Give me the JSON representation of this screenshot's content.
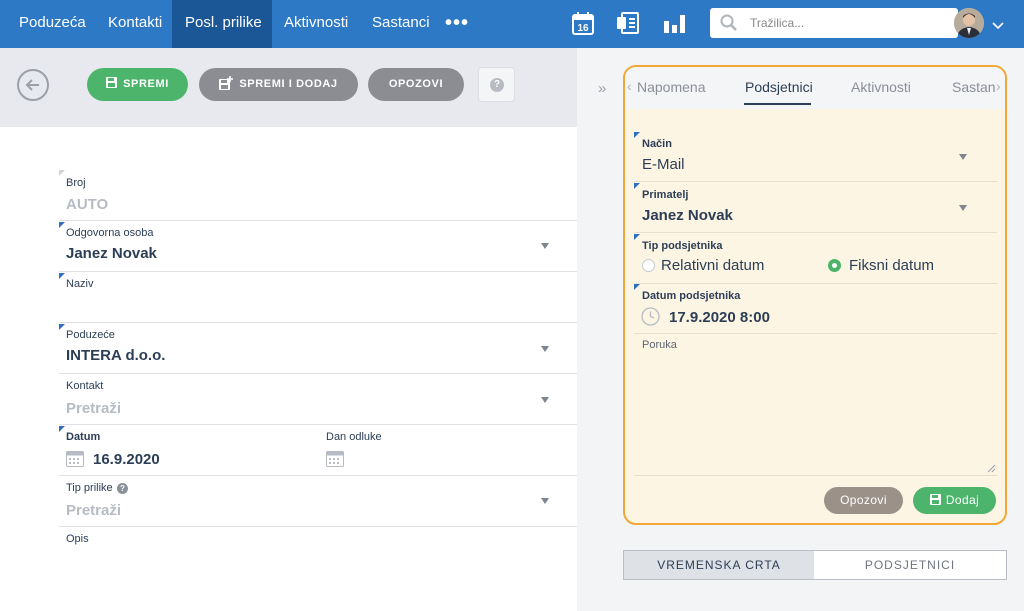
{
  "nav": {
    "items": [
      "Poduzeća",
      "Kontakti",
      "Posl. prilike",
      "Aktivnosti",
      "Sastanci"
    ],
    "active_index": 2,
    "more": "•••",
    "calendar_day": "16",
    "search_placeholder": "Tražilica..."
  },
  "toolbar": {
    "save": "SPREMI",
    "save_add": "SPREMI I DODAJ",
    "cancel": "OPOZOVI",
    "help": "?"
  },
  "form": {
    "broj_label": "Broj",
    "broj_value": "AUTO",
    "odgovorna_label": "Odgovorna osoba",
    "odgovorna_value": "Janez Novak",
    "naziv_label": "Naziv",
    "naziv_value": "",
    "poduzece_label": "Poduzeće",
    "poduzece_value": "INTERA d.o.o.",
    "kontakt_label": "Kontakt",
    "kontakt_placeholder": "Pretraži",
    "datum_label": "Datum",
    "datum_value": "16.9.2020",
    "dan_odluke_label": "Dan odluke",
    "tip_label": "Tip prilike",
    "tip_placeholder": "Pretraži",
    "opis_label": "Opis"
  },
  "panel": {
    "tabs": [
      "Napomena",
      "Podsjetnici",
      "Aktivnosti",
      "Sastan"
    ],
    "active_tab": "Podsjetnici",
    "nacin_label": "Način",
    "nacin_value": "E-Mail",
    "primatelj_label": "Primatelj",
    "primatelj_value": "Janez Novak",
    "tip_label": "Tip podsjetnika",
    "tip_options": [
      "Relativni datum",
      "Fiksni datum"
    ],
    "tip_selected": "Fiksni datum",
    "datum_label": "Datum podsjetnika",
    "datum_value": "17.9.2020 8:00",
    "poruka_label": "Poruka",
    "cancel": "Opozovi",
    "add": "Dodaj"
  },
  "bottom_tabs": [
    "VREMENSKA CRTA",
    "PODSJETNICI"
  ],
  "colors": {
    "nav_bg": "#2d79c5",
    "nav_active": "#1b5797",
    "green": "#4cb56b",
    "gray_button": "#8b8d93",
    "highlight_border": "#f2a838",
    "panel_bg": "#fdf5e4"
  }
}
